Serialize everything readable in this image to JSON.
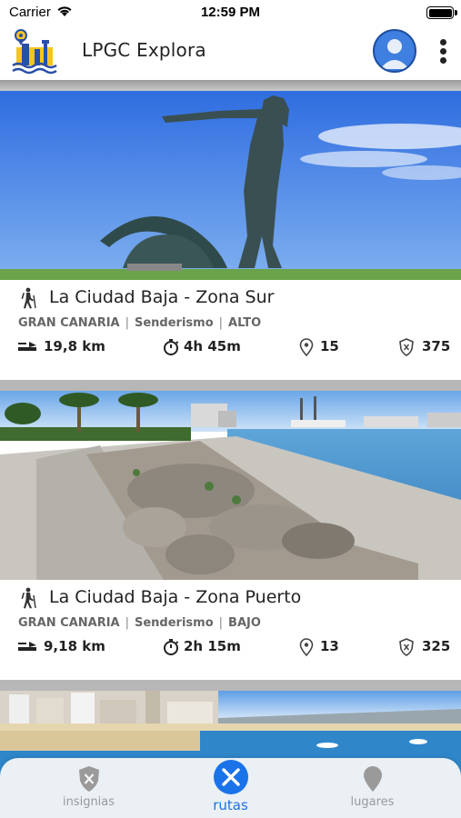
{
  "status_bar": {
    "carrier": "Carrier",
    "time": "12:59 PM"
  },
  "app": {
    "title": "LPGC Explora",
    "logo_icon": "city-pin-logo-icon",
    "avatar_icon": "user-avatar-icon",
    "menu_icon": "more-vertical-icon"
  },
  "routes": [
    {
      "title": "La Ciudad Baja - Zona Sur",
      "island": "GRAN CANARIA",
      "activity": "Senderismo",
      "difficulty": "ALTO",
      "distance": "19,8 km",
      "duration": "4h 45m",
      "places": "15",
      "points": "375",
      "image": "statue-monument-photo"
    },
    {
      "title": "La Ciudad Baja - Zona Puerto",
      "island": "GRAN CANARIA",
      "activity": "Senderismo",
      "difficulty": "BAJO",
      "distance": "9,18 km",
      "duration": "2h 15m",
      "places": "13",
      "points": "325",
      "image": "port-promenade-photo"
    },
    {
      "image": "beach-city-photo"
    }
  ],
  "tabs": [
    {
      "label": "insignias",
      "icon": "badge-shield-icon",
      "active": false
    },
    {
      "label": "rutas",
      "icon": "routes-icon",
      "active": true
    },
    {
      "label": "lugares",
      "icon": "place-pin-icon",
      "active": false
    }
  ],
  "colors": {
    "accent": "#1a73e8",
    "separator": "#b7b7b7",
    "tab_inactive": "#9a9a9a"
  }
}
